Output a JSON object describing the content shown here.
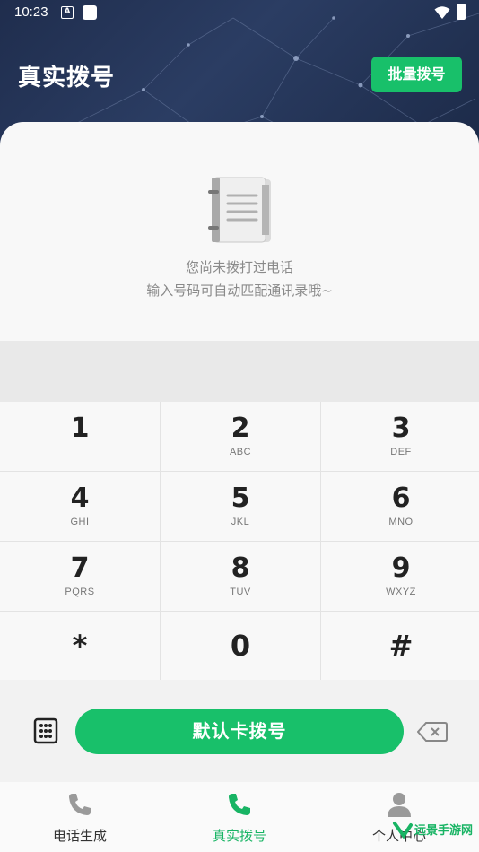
{
  "status_bar": {
    "time": "10:23",
    "icon_a": "A"
  },
  "header": {
    "title": "真实拨号",
    "batch_button": "批量拨号"
  },
  "empty_state": {
    "line1": "您尚未拨打过电话",
    "line2": "输入号码可自动匹配通讯录哦~"
  },
  "keypad": {
    "keys": [
      {
        "digit": "1",
        "letters": ""
      },
      {
        "digit": "2",
        "letters": "ABC"
      },
      {
        "digit": "3",
        "letters": "DEF"
      },
      {
        "digit": "4",
        "letters": "GHI"
      },
      {
        "digit": "5",
        "letters": "JKL"
      },
      {
        "digit": "6",
        "letters": "MNO"
      },
      {
        "digit": "7",
        "letters": "PQRS"
      },
      {
        "digit": "8",
        "letters": "TUV"
      },
      {
        "digit": "9",
        "letters": "WXYZ"
      },
      {
        "digit": "*",
        "letters": ""
      },
      {
        "digit": "0",
        "letters": ""
      },
      {
        "digit": "#",
        "letters": ""
      }
    ]
  },
  "dial": {
    "button_label": "默认卡拨号"
  },
  "bottom_nav": {
    "items": [
      {
        "label": "电话生成",
        "icon": "phone-icon"
      },
      {
        "label": "真实拨号",
        "icon": "phone-icon"
      },
      {
        "label": "个人中心",
        "icon": "person-icon"
      }
    ],
    "active_index": 1
  },
  "watermark": {
    "text": "远景手游网"
  },
  "colors": {
    "accent": "#18c06a",
    "header_bg": "#26365a"
  }
}
